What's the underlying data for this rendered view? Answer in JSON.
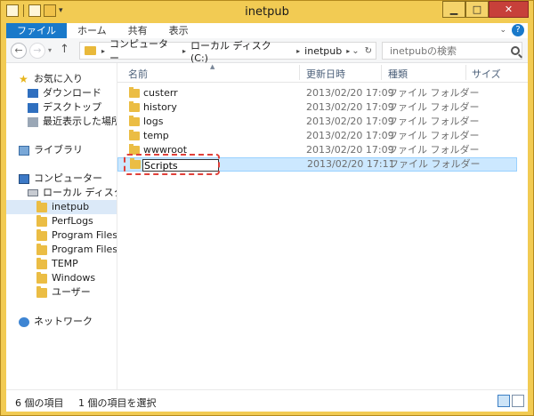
{
  "window": {
    "title": "inetpub",
    "controls": {
      "minimize": "▁",
      "maximize": "□",
      "close": "✕"
    }
  },
  "ribbon": {
    "tabs": [
      {
        "label": "ファイル",
        "active": true
      },
      {
        "label": "ホーム",
        "active": false
      },
      {
        "label": "共有",
        "active": false
      },
      {
        "label": "表示",
        "active": false
      }
    ],
    "expand_caret": "⌄",
    "help": "?"
  },
  "navigation": {
    "back": "←",
    "forward": "→",
    "recent_dropdown": "▾",
    "up": "↑",
    "breadcrumb": [
      "コンピューター",
      "ローカル ディスク (C:)",
      "inetpub"
    ],
    "address_dropdown": "⌄",
    "refresh": "↻",
    "search_placeholder": "inetpubの検索"
  },
  "nav_pane": {
    "favorites": {
      "label": "お気に入り",
      "items": [
        "ダウンロード",
        "デスクトップ",
        "最近表示した場所"
      ]
    },
    "libraries": {
      "label": "ライブラリ"
    },
    "computer": {
      "label": "コンピューター",
      "drive": "ローカル ディスク (C:)",
      "folders": [
        {
          "label": "inetpub",
          "selected": true
        },
        {
          "label": "PerfLogs",
          "selected": false
        },
        {
          "label": "Program Files",
          "selected": false
        },
        {
          "label": "Program Files (x",
          "selected": false
        },
        {
          "label": "TEMP",
          "selected": false
        },
        {
          "label": "Windows",
          "selected": false
        },
        {
          "label": "ユーザー",
          "selected": false
        }
      ]
    },
    "network": {
      "label": "ネットワーク"
    }
  },
  "file_list": {
    "columns": [
      "名前",
      "更新日時",
      "種類",
      "サイズ"
    ],
    "sort_indicator": "▲",
    "rows": [
      {
        "name": "custerr",
        "modified": "2013/02/20 17:09",
        "type": "ファイル フォルダー",
        "editing": false
      },
      {
        "name": "history",
        "modified": "2013/02/20 17:09",
        "type": "ファイル フォルダー",
        "editing": false
      },
      {
        "name": "logs",
        "modified": "2013/02/20 17:09",
        "type": "ファイル フォルダー",
        "editing": false
      },
      {
        "name": "temp",
        "modified": "2013/02/20 17:09",
        "type": "ファイル フォルダー",
        "editing": false
      },
      {
        "name": "wwwroot",
        "modified": "2013/02/20 17:09",
        "type": "ファイル フォルダー",
        "editing": false
      },
      {
        "name": "Scripts",
        "modified": "2013/02/20 17:11",
        "type": "ファイル フォルダー",
        "editing": true
      }
    ],
    "highlight_color": "#e0403a"
  },
  "status_bar": {
    "item_count": "6 個の項目",
    "selection": "1 個の項目を選択"
  }
}
